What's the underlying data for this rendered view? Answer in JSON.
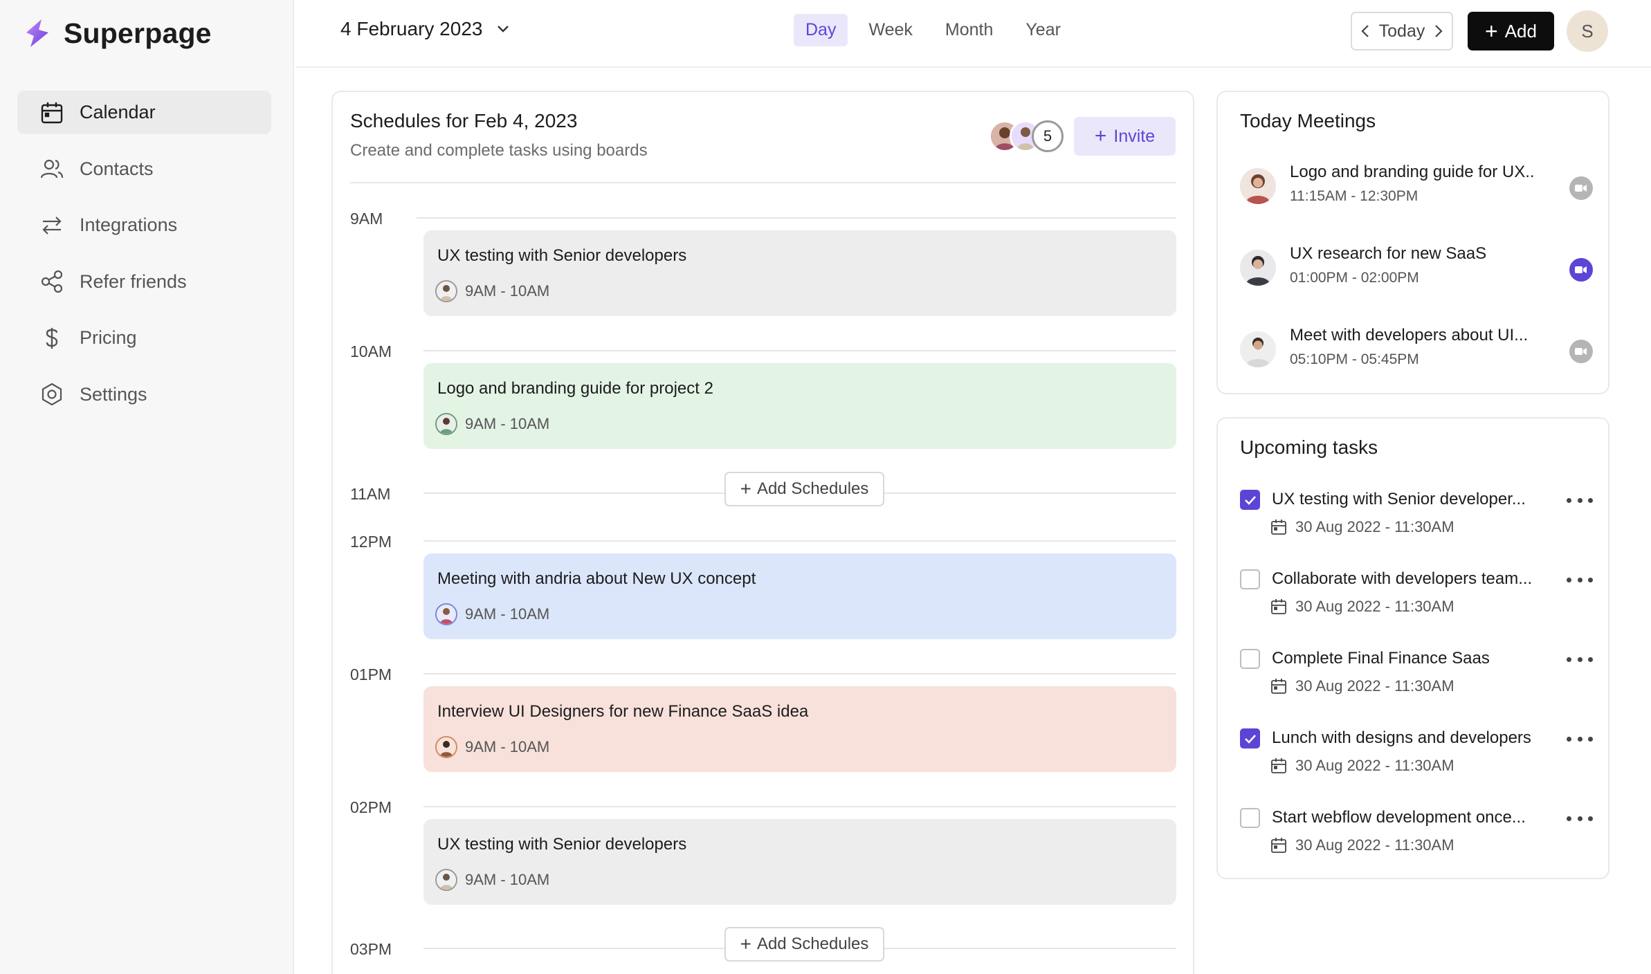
{
  "app": {
    "name": "Superpage"
  },
  "sidebar": {
    "items": [
      {
        "label": "Calendar",
        "icon": "calendar-icon",
        "active": true
      },
      {
        "label": "Contacts",
        "icon": "contacts-icon",
        "active": false
      },
      {
        "label": "Integrations",
        "icon": "integrations-icon",
        "active": false
      },
      {
        "label": "Refer friends",
        "icon": "share-icon",
        "active": false
      },
      {
        "label": "Pricing",
        "icon": "dollar-icon",
        "active": false
      },
      {
        "label": "Settings",
        "icon": "settings-icon",
        "active": false
      }
    ]
  },
  "topbar": {
    "date": "4 February 2023",
    "views": [
      "Day",
      "Week",
      "Month",
      "Year"
    ],
    "active_view": "Day",
    "today_label": "Today",
    "add_label": "Add",
    "user_initial": "S"
  },
  "schedule": {
    "title": "Schedules for Feb 4, 2023",
    "subtitle": "Create and complete tasks using boards",
    "member_count": "5",
    "invite_label": "Invite",
    "add_schedules_label": "Add Schedules",
    "times": [
      "9AM",
      "10AM",
      "11AM",
      "12PM",
      "01PM",
      "02PM",
      "03PM"
    ],
    "events": [
      {
        "title": "UX testing with Senior developers",
        "time": "9AM - 10AM",
        "color": "#ededed"
      },
      {
        "title": "Logo and branding guide for project 2",
        "time": "9AM - 10AM",
        "color": "#e3f3e4"
      },
      {
        "title": "Meeting with andria about New UX concept",
        "time": "9AM - 10AM",
        "color": "#dce6fb"
      },
      {
        "title": "Interview UI Designers for new Finance SaaS idea",
        "time": "9AM - 10AM",
        "color": "#f7e1da"
      },
      {
        "title": "UX testing with Senior developers",
        "time": "9AM - 10AM",
        "color": "#ededed"
      }
    ]
  },
  "meetings": {
    "title": "Today Meetings",
    "items": [
      {
        "title": "Logo and branding guide for UX..",
        "time": "11:15AM - 12:30PM",
        "video_active": false
      },
      {
        "title": "UX research for new SaaS",
        "time": "01:00PM - 02:00PM",
        "video_active": true
      },
      {
        "title": "Meet with developers about UI...",
        "time": "05:10PM - 05:45PM",
        "video_active": false
      }
    ]
  },
  "tasks": {
    "title": "Upcoming tasks",
    "items": [
      {
        "title": "UX testing with Senior developer...",
        "date": "30 Aug 2022 - 11:30AM",
        "checked": true
      },
      {
        "title": "Collaborate with developers team...",
        "date": "30 Aug 2022 - 11:30AM",
        "checked": false
      },
      {
        "title": "Complete Final Finance Saas",
        "date": "30 Aug 2022 - 11:30AM",
        "checked": false
      },
      {
        "title": "Lunch with designs and developers",
        "date": "30 Aug 2022 - 11:30AM",
        "checked": true
      },
      {
        "title": "Start webflow development once...",
        "date": "30 Aug 2022 - 11:30AM",
        "checked": false
      }
    ]
  },
  "colors": {
    "accent": "#5b45d6",
    "accent_soft": "#ebe7fb",
    "video_inactive": "#b5b5b5"
  }
}
